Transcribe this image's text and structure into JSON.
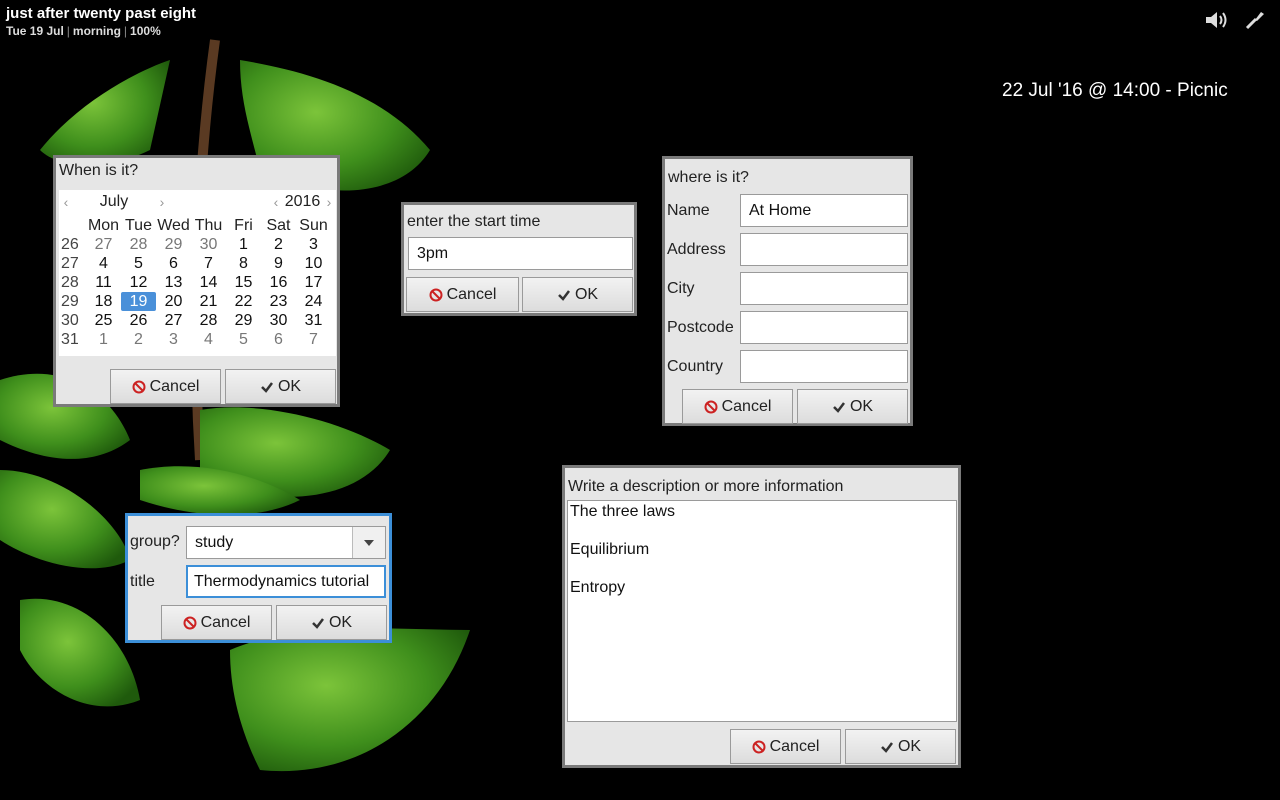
{
  "topbar": {
    "time_phrase": "just after twenty past eight",
    "date": "Tue 19 Jul",
    "period": "morning",
    "battery": "100%",
    "icons": [
      "volume-icon",
      "settings-tool-icon"
    ]
  },
  "event_label": "22 Jul '16 @ 14:00 - Picnic",
  "calendar_dialog": {
    "title": "When is it?",
    "month": "July",
    "year": "2016",
    "weekdays": [
      "Mon",
      "Tue",
      "Wed",
      "Thu",
      "Fri",
      "Sat",
      "Sun"
    ],
    "weeks": [
      {
        "week": "26",
        "days": [
          "27",
          "28",
          "29",
          "30",
          "1",
          "2",
          "3"
        ]
      },
      {
        "week": "27",
        "days": [
          "4",
          "5",
          "6",
          "7",
          "8",
          "9",
          "10"
        ]
      },
      {
        "week": "28",
        "days": [
          "11",
          "12",
          "13",
          "14",
          "15",
          "16",
          "17"
        ]
      },
      {
        "week": "29",
        "days": [
          "18",
          "19",
          "20",
          "21",
          "22",
          "23",
          "24"
        ]
      },
      {
        "week": "30",
        "days": [
          "25",
          "26",
          "27",
          "28",
          "29",
          "30",
          "31"
        ]
      },
      {
        "week": "31",
        "days": [
          "1",
          "2",
          "3",
          "4",
          "5",
          "6",
          "7"
        ]
      }
    ],
    "selected_day": "19",
    "cancel_label": "Cancel",
    "ok_label": "OK"
  },
  "time_dialog": {
    "title": "enter the start time",
    "value": "3pm",
    "cancel_label": "Cancel",
    "ok_label": "OK"
  },
  "location_dialog": {
    "title": "where is it?",
    "fields": [
      {
        "label": "Name",
        "value": "At Home"
      },
      {
        "label": "Address",
        "value": ""
      },
      {
        "label": "City",
        "value": ""
      },
      {
        "label": "Postcode",
        "value": ""
      },
      {
        "label": "Country",
        "value": ""
      }
    ],
    "cancel_label": "Cancel",
    "ok_label": "OK"
  },
  "group_dialog": {
    "group_label": "group?",
    "group_value": "study",
    "title_label": "title",
    "title_value": "Thermodynamics tutorial",
    "cancel_label": "Cancel",
    "ok_label": "OK"
  },
  "description_dialog": {
    "title": "Write a description or more information",
    "lines": [
      "The three laws",
      "Equilibrium",
      "Entropy"
    ],
    "cancel_label": "Cancel",
    "ok_label": "OK"
  },
  "colors": {
    "accent": "#4a90d9",
    "dialog_bg": "#e6e6e6",
    "cancel_icon": "#cc2222"
  }
}
